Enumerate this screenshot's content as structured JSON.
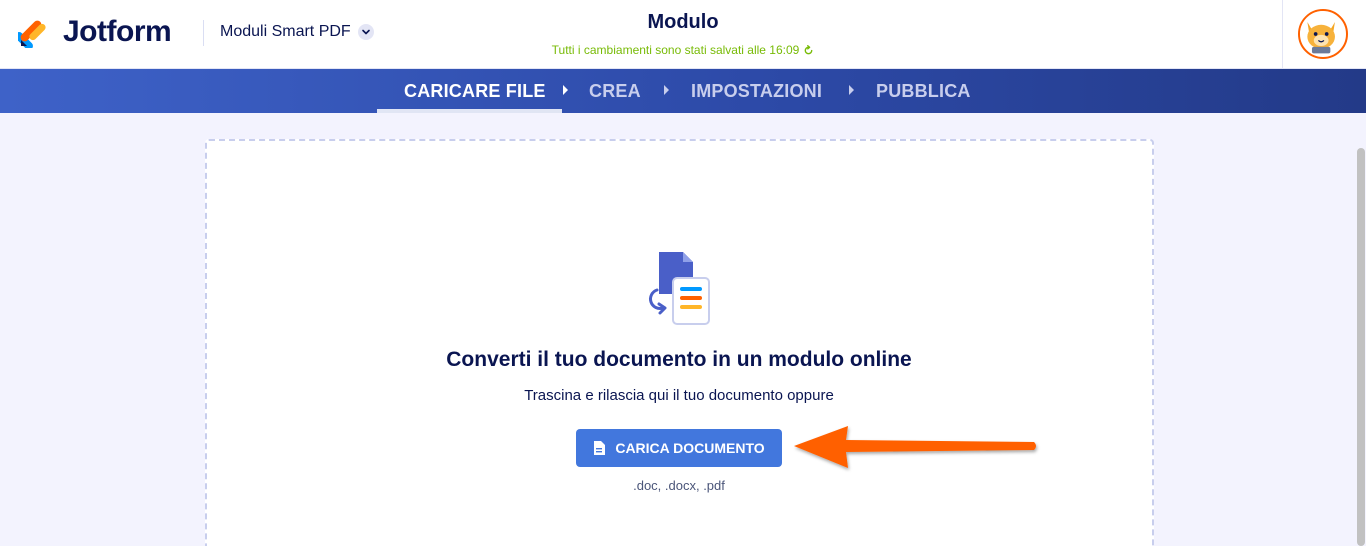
{
  "app": {
    "logo_text": "Jotform",
    "form_type_label": "Moduli Smart PDF",
    "form_title": "Modulo",
    "save_status": "Tutti i cambiamenti sono stati salvati alle 16:09"
  },
  "nav": {
    "steps": [
      {
        "label": "CARICARE FILE",
        "active": true
      },
      {
        "label": "CREA",
        "active": false
      },
      {
        "label": "IMPOSTAZIONI",
        "active": false
      },
      {
        "label": "PUBBLICA",
        "active": false
      }
    ]
  },
  "upload": {
    "headline": "Converti il tuo documento in un modulo online",
    "subline": "Trascina e rilascia qui il tuo documento oppure",
    "button_label": "CARICA DOCUMENTO",
    "formats": ".doc, .docx, .pdf"
  },
  "colors": {
    "brand_navy": "#0a1551",
    "nav_blue": "#2d4aa8",
    "button_blue": "#4277dd",
    "status_green": "#78bb07",
    "annotation_orange": "#ff6100"
  },
  "icons": {
    "logo": "jotform-logo-icon",
    "dropdown": "chevron-down-icon",
    "refresh": "refresh-icon",
    "avatar": "user-avatar",
    "document": "document-icon",
    "convert": "document-convert-icon",
    "annotation": "arrow-annotation"
  }
}
